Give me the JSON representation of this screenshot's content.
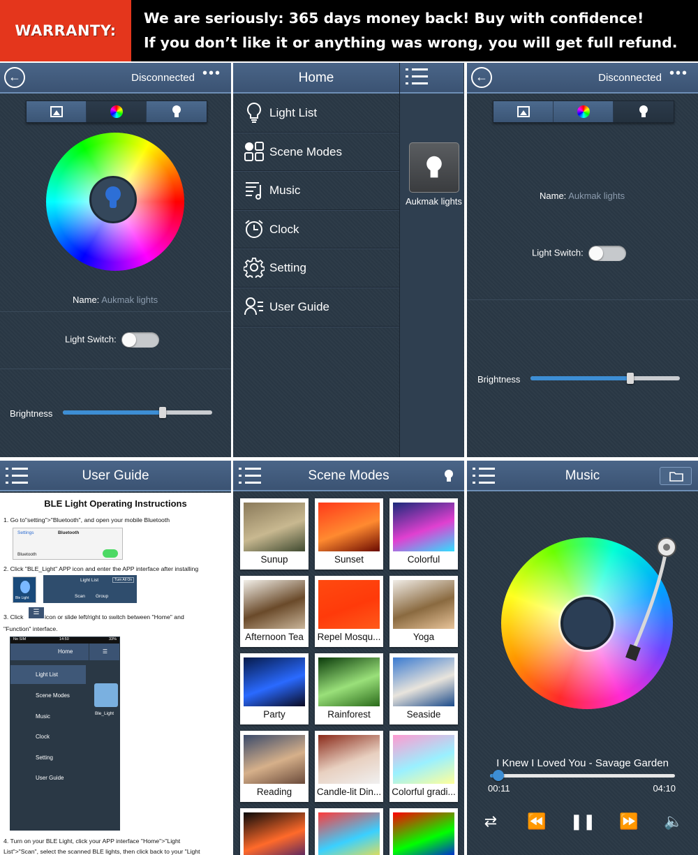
{
  "banner": {
    "badge": "WARRANTY:",
    "line1": "We are seriously: 365 days money back! Buy with confidence!",
    "line2": "If you don’t like it or anything was wrong, you will get full refund."
  },
  "color_screen": {
    "status": "Disconnected",
    "name_label": "Name:",
    "name_value": "Aukmak lights",
    "switch_label": "Light Switch:",
    "brightness_label": "Brightness",
    "brightness": 0.67
  },
  "home_screen": {
    "title": "Home",
    "menu": [
      {
        "label": "Light List",
        "icon": "bulb-outline-icon"
      },
      {
        "label": "Scene Modes",
        "icon": "grid-icon"
      },
      {
        "label": "Music",
        "icon": "music-note-icon"
      },
      {
        "label": "Clock",
        "icon": "alarm-clock-icon"
      },
      {
        "label": "Setting",
        "icon": "gear-icon"
      },
      {
        "label": "User Guide",
        "icon": "user-guide-icon"
      }
    ],
    "device_label": "Aukmak lights"
  },
  "white_screen": {
    "status": "Disconnected",
    "name_label": "Name:",
    "name_value": "Aukmak lights",
    "switch_label": "Light Switch:",
    "brightness_label": "Brightness",
    "brightness": 0.67
  },
  "user_guide": {
    "title": "User Guide",
    "doc_title": "BLE Light Operating Instructions",
    "step1": "1.  Go to\"setting\">\"Bluetooth\", and open your mobile Bluetooth",
    "step2": "2.  Click \"BLE_Light\" APP icon and enter the APP interface after installing",
    "step3a": "3.  Click",
    "step3b": "icon or slide left/right to switch between \"Home\" and",
    "step3c": "\"Function\" interface.",
    "step4a": "4.  Turn on your BLE Light, click your APP interface \"Home\">\"Light",
    "step4b": "List\">\"Scan\", select the scanned BLE lights, then click back to your \"Light",
    "mini_settings_back": "Settings",
    "mini_settings_title": "Bluetooth",
    "mini_bluetooth": "Bluetooth",
    "mini_app_label": "Ble Light",
    "mini_lightlist": "Light List",
    "mini_turnall": "Turn All On",
    "mini_scan": "Scan",
    "mini_group": "Group",
    "mini_status_left": "No SIM",
    "mini_status_time": "14:50",
    "mini_status_right": "33%",
    "mini_home": "Home",
    "mini_menu": [
      "Light List",
      "Scene Modes",
      "Music",
      "Clock",
      "Setting",
      "User Guide"
    ],
    "mini_device": "Ble_Light"
  },
  "scene_modes": {
    "title": "Scene Modes",
    "scenes": [
      {
        "label": "Sunup",
        "colors": [
          "#8a7a5a",
          "#c8b890",
          "#3f4a30"
        ]
      },
      {
        "label": "Sunset",
        "colors": [
          "#ff3a1a",
          "#ff8a30",
          "#6a0a00"
        ]
      },
      {
        "label": "Colorful",
        "colors": [
          "#1a2a7a",
          "#e040d0",
          "#30e0ff"
        ]
      },
      {
        "label": "Afternoon Tea",
        "colors": [
          "#f2efe8",
          "#6a4a2a",
          "#c9b59a"
        ]
      },
      {
        "label": "Repel Mosqu...",
        "colors": [
          "#ff4a10",
          "#ff3a0a",
          "#ff5a1a"
        ]
      },
      {
        "label": "Yoga",
        "colors": [
          "#f0ece6",
          "#8a6a40",
          "#e8c49a"
        ]
      },
      {
        "label": "Party",
        "colors": [
          "#061a4a",
          "#2a6aff",
          "#0a0a20"
        ]
      },
      {
        "label": "Rainforest",
        "colors": [
          "#0a3a0a",
          "#9ae07a",
          "#2a6a1a"
        ]
      },
      {
        "label": "Seaside",
        "colors": [
          "#3a7ad0",
          "#e8e4dc",
          "#1a4a8a"
        ]
      },
      {
        "label": "Reading",
        "colors": [
          "#3a4a6a",
          "#d6b08a",
          "#6a4a3a"
        ]
      },
      {
        "label": "Candle-lit Din...",
        "colors": [
          "#8a2a1a",
          "#e8d0c0",
          "#f0f0f0"
        ]
      },
      {
        "label": "Colorful gradi...",
        "colors": [
          "#ff9ad0",
          "#9af0ff",
          "#ffff9a"
        ]
      },
      {
        "label": "",
        "colors": [
          "#0a0a0a",
          "#ff6a2a",
          "#3a1a6a"
        ]
      },
      {
        "label": "",
        "colors": [
          "#ff3a3a",
          "#3ad0ff",
          "#ffe03a"
        ]
      },
      {
        "label": "",
        "colors": [
          "#ff0000",
          "#00ff00",
          "#0000ff"
        ]
      }
    ]
  },
  "music": {
    "title": "Music",
    "track": "I Knew I Loved You - Savage Garden",
    "elapsed": "00:11",
    "duration": "04:10",
    "progress": 0.045
  }
}
